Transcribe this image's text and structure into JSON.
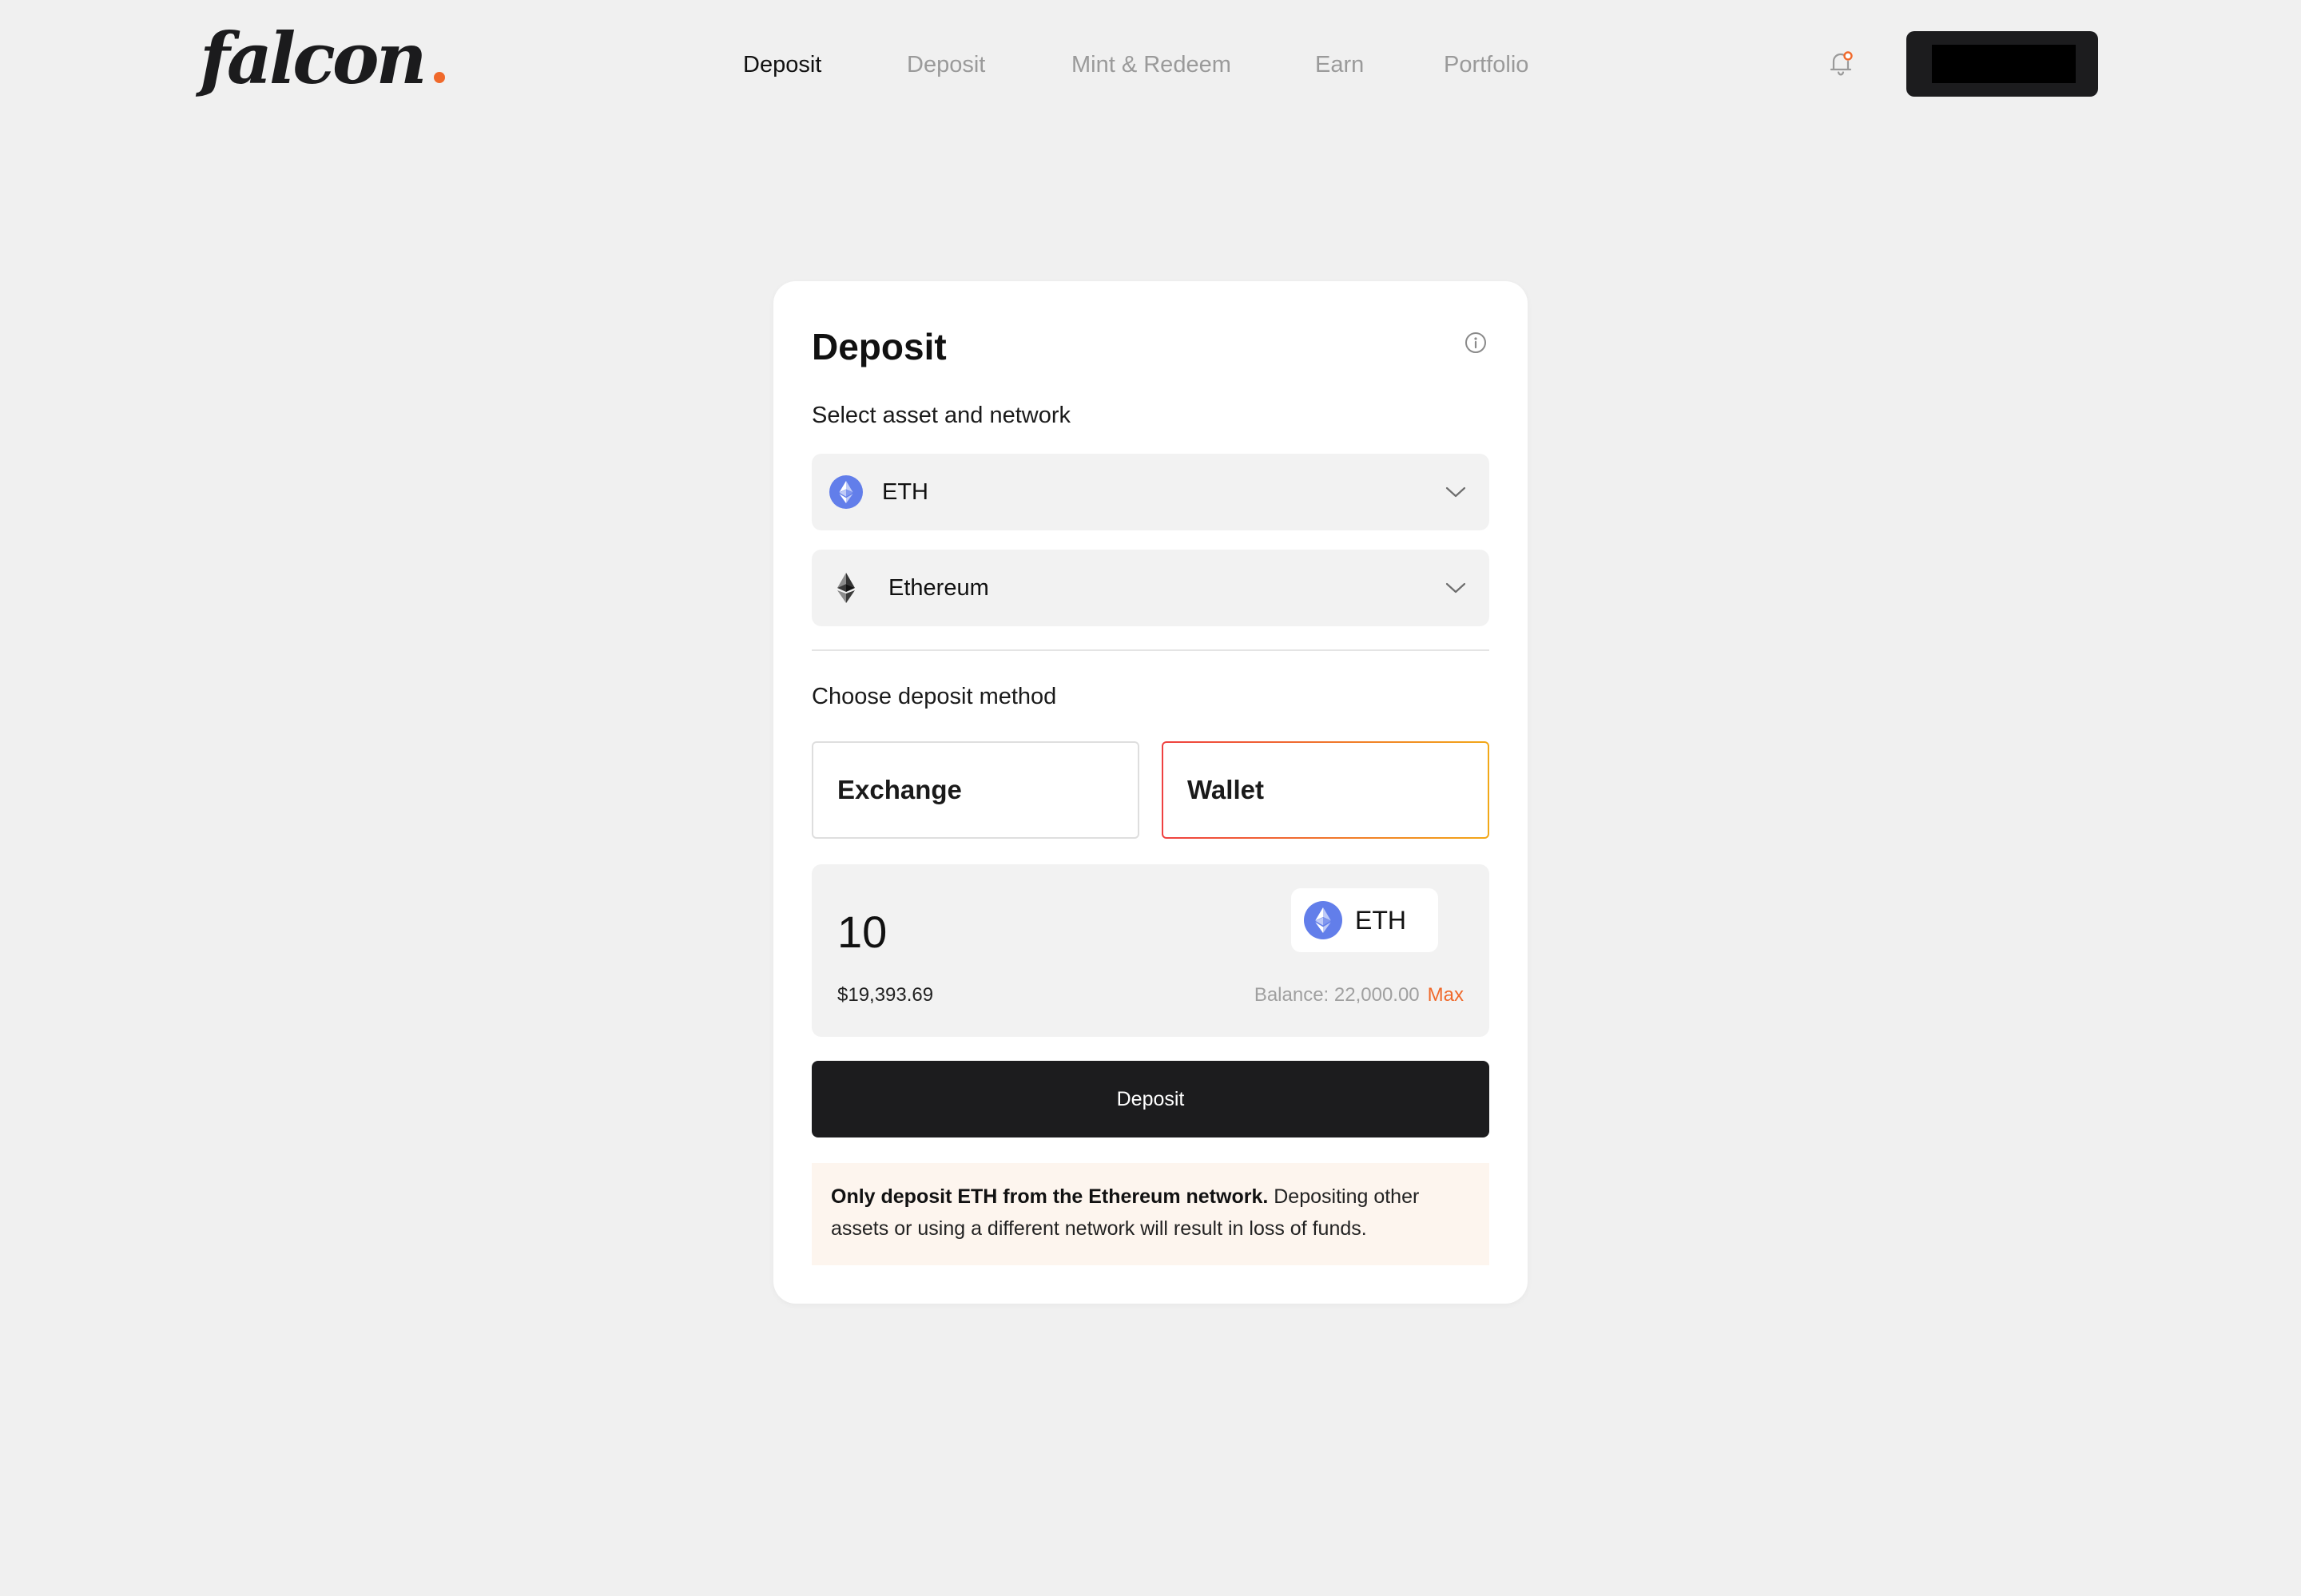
{
  "app": {
    "logo_text": "falcon",
    "logo_dot_color": "#f0692b"
  },
  "nav": {
    "items": [
      {
        "label": "Deposit",
        "active": true
      },
      {
        "label": "Deposit",
        "active": false
      },
      {
        "label": "Mint & Redeem",
        "active": false
      },
      {
        "label": "Earn",
        "active": false
      },
      {
        "label": "Portfolio",
        "active": false
      }
    ]
  },
  "header": {
    "notification_icon": "bell-icon",
    "notification_dot_color": "#f0692b",
    "wallet_button_label": ""
  },
  "card": {
    "title": "Deposit",
    "info_icon": "info-icon",
    "asset_section_label": "Select asset and network",
    "asset": {
      "value": "ETH",
      "icon": "eth-token-icon"
    },
    "network": {
      "value": "Ethereum",
      "icon": "ethereum-network-icon"
    },
    "method_section_label": "Choose deposit method",
    "methods": [
      {
        "label": "Exchange",
        "selected": false
      },
      {
        "label": "Wallet",
        "selected": true
      }
    ],
    "amount": {
      "value": "10",
      "usd_value": "$19,393.69",
      "token_label": "ETH",
      "balance_text": "Balance: 22,000.00",
      "max_label": "Max"
    },
    "deposit_button_label": "Deposit",
    "notice": {
      "bold": "Only deposit ETH from the Ethereum network.",
      "rest": " Depositing other assets or using a different network will result in loss of funds."
    }
  },
  "colors": {
    "accent": "#f0692b",
    "eth_blue": "#627eea",
    "primary_button": "#1c1c1e",
    "notice_bg": "#fdf5ee",
    "wallet_border_gradient": [
      "#ef4040",
      "#f2a818"
    ]
  }
}
